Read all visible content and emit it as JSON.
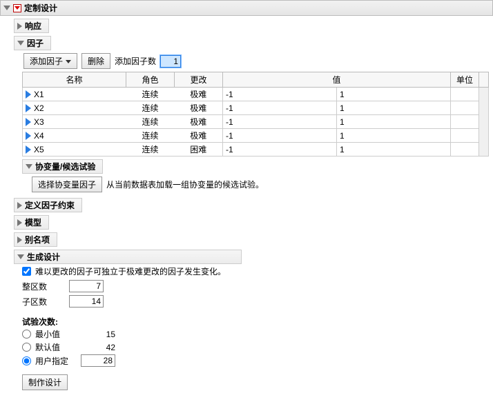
{
  "main": {
    "title": "定制设计"
  },
  "response": {
    "title": "响应"
  },
  "factors": {
    "title": "因子",
    "add_factor_label": "添加因子",
    "delete_label": "删除",
    "add_count_label": "添加因子数",
    "add_count_value": "1",
    "columns": {
      "name": "名称",
      "role": "角色",
      "change": "更改",
      "value": "值",
      "unit": "单位"
    },
    "rows": [
      {
        "name": "X1",
        "role": "连续",
        "change": "极难",
        "v1": "-1",
        "v2": "1"
      },
      {
        "name": "X2",
        "role": "连续",
        "change": "极难",
        "v1": "-1",
        "v2": "1"
      },
      {
        "name": "X3",
        "role": "连续",
        "change": "极难",
        "v1": "-1",
        "v2": "1"
      },
      {
        "name": "X4",
        "role": "连续",
        "change": "极难",
        "v1": "-1",
        "v2": "1"
      },
      {
        "name": "X5",
        "role": "连续",
        "change": "困难",
        "v1": "-1",
        "v2": "1"
      }
    ]
  },
  "covariate": {
    "title": "协变量/候选试验",
    "button": "选择协变量因子",
    "desc": "从当前数据表加载一组协变量的候选试验。"
  },
  "constraints": {
    "title": "定义因子约束"
  },
  "model": {
    "title": "模型"
  },
  "alias": {
    "title": "别名项"
  },
  "generate": {
    "title": "生成设计",
    "checkbox_label": "难以更改的因子可独立于极难更改的因子发生变化。",
    "whole_plot_label": "整区数",
    "whole_plot_value": "7",
    "sub_plot_label": "子区数",
    "sub_plot_value": "14",
    "trials_header": "试验次数:",
    "min_label": "最小值",
    "min_value": "15",
    "default_label": "默认值",
    "default_value": "42",
    "user_label": "用户指定",
    "user_value": "28",
    "make_design_label": "制作设计"
  }
}
